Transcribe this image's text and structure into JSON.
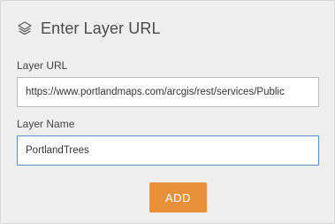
{
  "dialog": {
    "title": "Enter Layer URL",
    "title_icon": "layers-icon"
  },
  "form": {
    "url_label": "Layer URL",
    "url_value": "https://www.portlandmaps.com/arcgis/rest/services/Public",
    "name_label": "Layer Name",
    "name_value": "PortlandTrees"
  },
  "actions": {
    "add_label": "ADD"
  },
  "colors": {
    "panel_background": "#efefef",
    "add_button": "#e8913a",
    "focused_border": "#5b8ec5"
  }
}
